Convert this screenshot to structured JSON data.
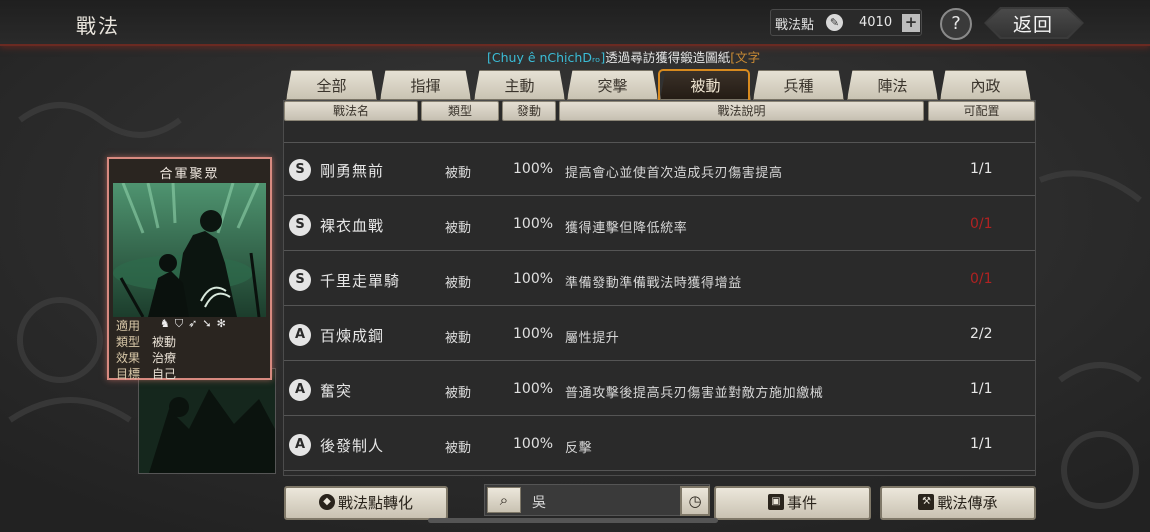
{
  "header": {
    "title": "戰法",
    "points_label": "戰法點",
    "points_icon": "coin-icon",
    "points_value": "4010",
    "plus_label": "+",
    "help_label": "?",
    "back_label": "返回"
  },
  "announcement": {
    "prefix": "[Chuy ê nChịchDᵣₒ]",
    "text": "透過尋訪獲得鍛造圖紙",
    "suffix": "[文字"
  },
  "tabs": [
    {
      "label": "全部",
      "active": false
    },
    {
      "label": "指揮",
      "active": false
    },
    {
      "label": "主動",
      "active": false
    },
    {
      "label": "突擊",
      "active": false
    },
    {
      "label": "被動",
      "active": true
    },
    {
      "label": "兵種",
      "active": false
    },
    {
      "label": "陣法",
      "active": false
    },
    {
      "label": "內政",
      "active": false
    }
  ],
  "columns": [
    "戰法名",
    "類型",
    "發動",
    "戰法說明",
    "可配置"
  ],
  "skills": [
    {
      "rank": "S",
      "name": "剛勇無前",
      "type": "被動",
      "rate": "100%",
      "desc": "提高會心並使首次造成兵刃傷害提高",
      "config": "1/1",
      "config_red": false
    },
    {
      "rank": "S",
      "name": "裸衣血戰",
      "type": "被動",
      "rate": "100%",
      "desc": "獲得連擊但降低統率",
      "config": "0/1",
      "config_red": true
    },
    {
      "rank": "S",
      "name": "千里走單騎",
      "type": "被動",
      "rate": "100%",
      "desc": "準備發動準備戰法時獲得增益",
      "config": "0/1",
      "config_red": true
    },
    {
      "rank": "A",
      "name": "百煉成鋼",
      "type": "被動",
      "rate": "100%",
      "desc": "屬性提升",
      "config": "2/2",
      "config_red": false
    },
    {
      "rank": "A",
      "name": "奮突",
      "type": "被動",
      "rate": "100%",
      "desc": "普通攻擊後提高兵刃傷害並對敵方施加繳械",
      "config": "1/1",
      "config_red": false
    },
    {
      "rank": "A",
      "name": "後發制人",
      "type": "被動",
      "rate": "100%",
      "desc": "反擊",
      "config": "1/1",
      "config_red": false
    }
  ],
  "card": {
    "title": "合軍聚眾",
    "apply_label": "適用",
    "apply_icons": [
      "cavalry-icon",
      "shield-icon",
      "bow-icon",
      "spear-icon",
      "wheel-icon"
    ],
    "type_label": "類型",
    "type_value": "被動",
    "effect_label": "效果",
    "effect_value": "治療",
    "target_label": "目標",
    "target_value": "自己"
  },
  "bottom": {
    "convert_label": "戰法點轉化",
    "search_value": "吳",
    "events_label": "事件",
    "inherit_label": "戰法傳承"
  },
  "colors": {
    "tab_active_border": "#d88a1e",
    "config_red": "#b02222",
    "announce_highlight": "#3bbcd6"
  }
}
